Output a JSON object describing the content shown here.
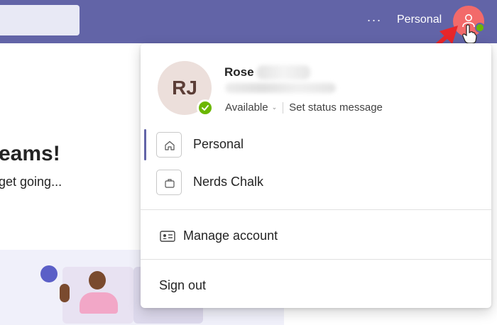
{
  "topbar": {
    "more_label": "···",
    "org_label": "Personal",
    "avatar_icon": "person-icon",
    "presence_color": "#6bb700",
    "bar_color": "#6264a7"
  },
  "background": {
    "heading": "eams!",
    "subtext": "get going..."
  },
  "account_menu": {
    "initials": "RJ",
    "user_name": "Rose",
    "status": "Available",
    "status_chevron": "⌄",
    "set_status": "Set status message",
    "accounts": [
      {
        "label": "Personal",
        "icon": "home-icon",
        "selected": true
      },
      {
        "label": "Nerds Chalk",
        "icon": "briefcase-icon",
        "selected": false
      }
    ],
    "manage_account": "Manage account",
    "manage_icon": "contact-card-icon",
    "sign_out": "Sign out"
  }
}
